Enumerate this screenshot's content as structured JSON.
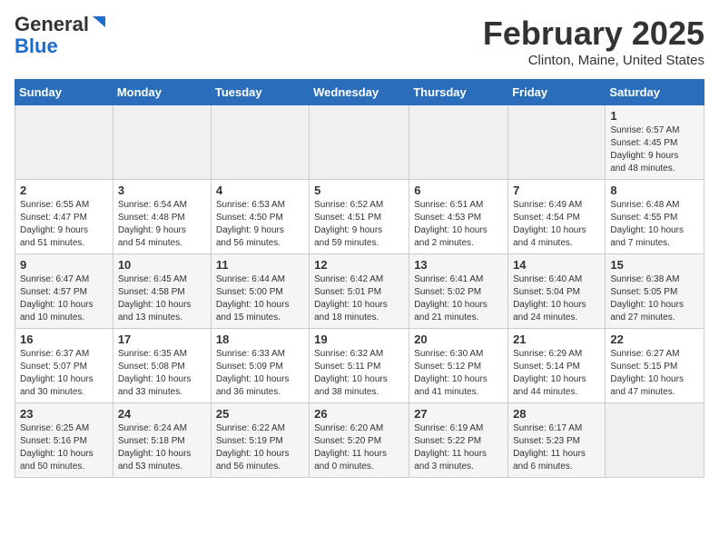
{
  "header": {
    "logo_general": "General",
    "logo_blue": "Blue",
    "month_title": "February 2025",
    "subtitle": "Clinton, Maine, United States"
  },
  "days_of_week": [
    "Sunday",
    "Monday",
    "Tuesday",
    "Wednesday",
    "Thursday",
    "Friday",
    "Saturday"
  ],
  "weeks": [
    [
      {
        "day": "",
        "info": ""
      },
      {
        "day": "",
        "info": ""
      },
      {
        "day": "",
        "info": ""
      },
      {
        "day": "",
        "info": ""
      },
      {
        "day": "",
        "info": ""
      },
      {
        "day": "",
        "info": ""
      },
      {
        "day": "1",
        "info": "Sunrise: 6:57 AM\nSunset: 4:45 PM\nDaylight: 9 hours\nand 48 minutes."
      }
    ],
    [
      {
        "day": "2",
        "info": "Sunrise: 6:55 AM\nSunset: 4:47 PM\nDaylight: 9 hours\nand 51 minutes."
      },
      {
        "day": "3",
        "info": "Sunrise: 6:54 AM\nSunset: 4:48 PM\nDaylight: 9 hours\nand 54 minutes."
      },
      {
        "day": "4",
        "info": "Sunrise: 6:53 AM\nSunset: 4:50 PM\nDaylight: 9 hours\nand 56 minutes."
      },
      {
        "day": "5",
        "info": "Sunrise: 6:52 AM\nSunset: 4:51 PM\nDaylight: 9 hours\nand 59 minutes."
      },
      {
        "day": "6",
        "info": "Sunrise: 6:51 AM\nSunset: 4:53 PM\nDaylight: 10 hours\nand 2 minutes."
      },
      {
        "day": "7",
        "info": "Sunrise: 6:49 AM\nSunset: 4:54 PM\nDaylight: 10 hours\nand 4 minutes."
      },
      {
        "day": "8",
        "info": "Sunrise: 6:48 AM\nSunset: 4:55 PM\nDaylight: 10 hours\nand 7 minutes."
      }
    ],
    [
      {
        "day": "9",
        "info": "Sunrise: 6:47 AM\nSunset: 4:57 PM\nDaylight: 10 hours\nand 10 minutes."
      },
      {
        "day": "10",
        "info": "Sunrise: 6:45 AM\nSunset: 4:58 PM\nDaylight: 10 hours\nand 13 minutes."
      },
      {
        "day": "11",
        "info": "Sunrise: 6:44 AM\nSunset: 5:00 PM\nDaylight: 10 hours\nand 15 minutes."
      },
      {
        "day": "12",
        "info": "Sunrise: 6:42 AM\nSunset: 5:01 PM\nDaylight: 10 hours\nand 18 minutes."
      },
      {
        "day": "13",
        "info": "Sunrise: 6:41 AM\nSunset: 5:02 PM\nDaylight: 10 hours\nand 21 minutes."
      },
      {
        "day": "14",
        "info": "Sunrise: 6:40 AM\nSunset: 5:04 PM\nDaylight: 10 hours\nand 24 minutes."
      },
      {
        "day": "15",
        "info": "Sunrise: 6:38 AM\nSunset: 5:05 PM\nDaylight: 10 hours\nand 27 minutes."
      }
    ],
    [
      {
        "day": "16",
        "info": "Sunrise: 6:37 AM\nSunset: 5:07 PM\nDaylight: 10 hours\nand 30 minutes."
      },
      {
        "day": "17",
        "info": "Sunrise: 6:35 AM\nSunset: 5:08 PM\nDaylight: 10 hours\nand 33 minutes."
      },
      {
        "day": "18",
        "info": "Sunrise: 6:33 AM\nSunset: 5:09 PM\nDaylight: 10 hours\nand 36 minutes."
      },
      {
        "day": "19",
        "info": "Sunrise: 6:32 AM\nSunset: 5:11 PM\nDaylight: 10 hours\nand 38 minutes."
      },
      {
        "day": "20",
        "info": "Sunrise: 6:30 AM\nSunset: 5:12 PM\nDaylight: 10 hours\nand 41 minutes."
      },
      {
        "day": "21",
        "info": "Sunrise: 6:29 AM\nSunset: 5:14 PM\nDaylight: 10 hours\nand 44 minutes."
      },
      {
        "day": "22",
        "info": "Sunrise: 6:27 AM\nSunset: 5:15 PM\nDaylight: 10 hours\nand 47 minutes."
      }
    ],
    [
      {
        "day": "23",
        "info": "Sunrise: 6:25 AM\nSunset: 5:16 PM\nDaylight: 10 hours\nand 50 minutes."
      },
      {
        "day": "24",
        "info": "Sunrise: 6:24 AM\nSunset: 5:18 PM\nDaylight: 10 hours\nand 53 minutes."
      },
      {
        "day": "25",
        "info": "Sunrise: 6:22 AM\nSunset: 5:19 PM\nDaylight: 10 hours\nand 56 minutes."
      },
      {
        "day": "26",
        "info": "Sunrise: 6:20 AM\nSunset: 5:20 PM\nDaylight: 11 hours\nand 0 minutes."
      },
      {
        "day": "27",
        "info": "Sunrise: 6:19 AM\nSunset: 5:22 PM\nDaylight: 11 hours\nand 3 minutes."
      },
      {
        "day": "28",
        "info": "Sunrise: 6:17 AM\nSunset: 5:23 PM\nDaylight: 11 hours\nand 6 minutes."
      },
      {
        "day": "",
        "info": ""
      }
    ]
  ]
}
